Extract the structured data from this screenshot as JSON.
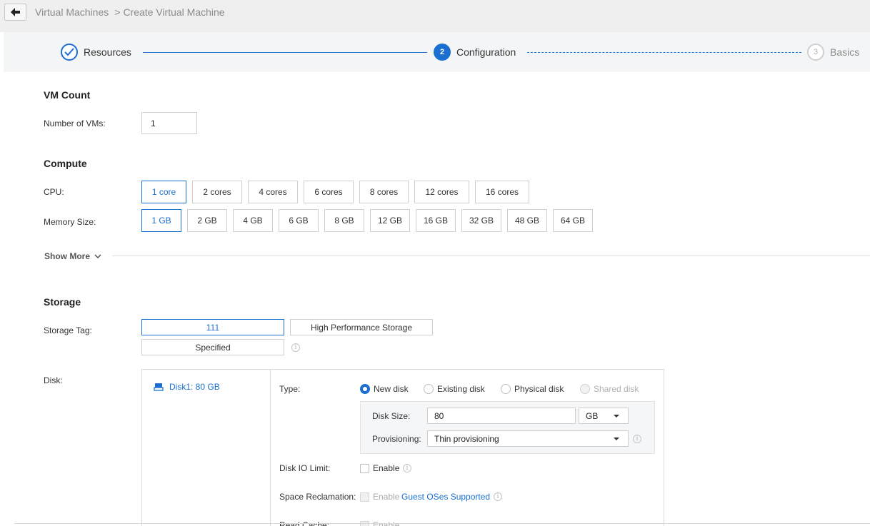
{
  "breadcrumb": {
    "parent": "Virtual Machines",
    "separator": ">",
    "current": "Create Virtual Machine"
  },
  "wizard": {
    "steps": [
      {
        "label": "Resources",
        "state": "done"
      },
      {
        "number": "2",
        "label": "Configuration",
        "state": "active"
      },
      {
        "number": "3",
        "label": "Basics",
        "state": "pending"
      }
    ]
  },
  "vm_count": {
    "title": "VM Count",
    "label": "Number of VMs:",
    "value": "1"
  },
  "compute": {
    "title": "Compute",
    "cpu_label": "CPU:",
    "cpu_options": [
      "1 core",
      "2 cores",
      "4 cores",
      "6 cores",
      "8 cores",
      "12 cores",
      "16 cores"
    ],
    "cpu_selected": "1 core",
    "memory_label": "Memory Size:",
    "memory_options": [
      "1 GB",
      "2 GB",
      "4 GB",
      "6 GB",
      "8 GB",
      "12 GB",
      "16 GB",
      "32 GB",
      "48 GB",
      "64 GB"
    ],
    "memory_selected": "1 GB",
    "show_more": "Show More"
  },
  "storage": {
    "title": "Storage",
    "tag_label": "Storage Tag:",
    "tags": [
      "111",
      "High Performance Storage",
      "Specified"
    ],
    "tag_selected": "111",
    "disk_label": "Disk:",
    "disk_item": "Disk1:  80 GB",
    "type_label": "Type:",
    "types": [
      "New disk",
      "Existing disk",
      "Physical disk",
      "Shared disk"
    ],
    "type_selected": "New disk",
    "disk_size_label": "Disk Size:",
    "disk_size_value": "80",
    "disk_size_unit": "GB",
    "provisioning_label": "Provisioning:",
    "provisioning_value": "Thin provisioning",
    "io_limit_label": "Disk IO Limit:",
    "io_limit_enable": "Enable",
    "space_reclamation_label": "Space Reclamation:",
    "space_reclamation_enable": "Enable",
    "guest_oses_link": "Guest OSes Supported",
    "read_cache_label": "Read Cache:",
    "read_cache_enable": "Enable"
  },
  "colors": {
    "accent": "#1a6fd1",
    "border": "#cfcfcf",
    "header_bg": "#efefef"
  }
}
